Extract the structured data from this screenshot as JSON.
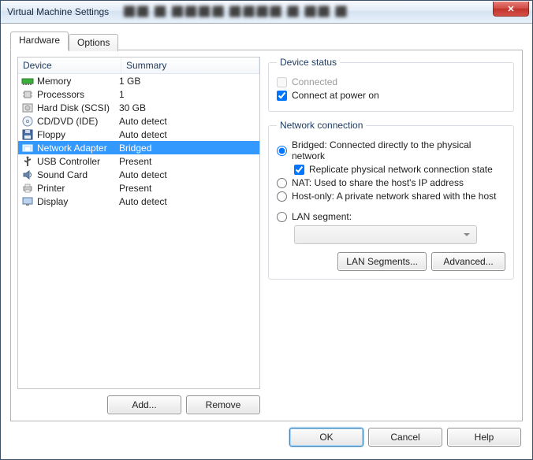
{
  "window": {
    "title": "Virtual Machine Settings"
  },
  "tabs": {
    "hardware": "Hardware",
    "options": "Options"
  },
  "device_table": {
    "col_device": "Device",
    "col_summary": "Summary",
    "rows": [
      {
        "icon": "memory",
        "name": "Memory",
        "summary": "1 GB",
        "selected": false
      },
      {
        "icon": "cpu",
        "name": "Processors",
        "summary": "1",
        "selected": false
      },
      {
        "icon": "hdd",
        "name": "Hard Disk (SCSI)",
        "summary": "30 GB",
        "selected": false
      },
      {
        "icon": "cd",
        "name": "CD/DVD (IDE)",
        "summary": "Auto detect",
        "selected": false
      },
      {
        "icon": "floppy",
        "name": "Floppy",
        "summary": "Auto detect",
        "selected": false
      },
      {
        "icon": "nic",
        "name": "Network Adapter",
        "summary": "Bridged",
        "selected": true
      },
      {
        "icon": "usb",
        "name": "USB Controller",
        "summary": "Present",
        "selected": false
      },
      {
        "icon": "sound",
        "name": "Sound Card",
        "summary": "Auto detect",
        "selected": false
      },
      {
        "icon": "printer",
        "name": "Printer",
        "summary": "Present",
        "selected": false
      },
      {
        "icon": "display",
        "name": "Display",
        "summary": "Auto detect",
        "selected": false
      }
    ]
  },
  "buttons": {
    "add": "Add...",
    "remove": "Remove",
    "lan_segments": "LAN Segments...",
    "advanced": "Advanced...",
    "ok": "OK",
    "cancel": "Cancel",
    "help": "Help"
  },
  "device_status": {
    "legend": "Device status",
    "connected_label": "Connected",
    "connected_checked": false,
    "connected_enabled": false,
    "power_on_label": "Connect at power on",
    "power_on_checked": true
  },
  "network": {
    "legend": "Network connection",
    "bridged_label": "Bridged: Connected directly to the physical network",
    "replicate_label": "Replicate physical network connection state",
    "replicate_checked": true,
    "nat_label": "NAT: Used to share the host's IP address",
    "hostonly_label": "Host-only: A private network shared with the host",
    "lan_label": "LAN segment:",
    "selected": "bridged"
  }
}
